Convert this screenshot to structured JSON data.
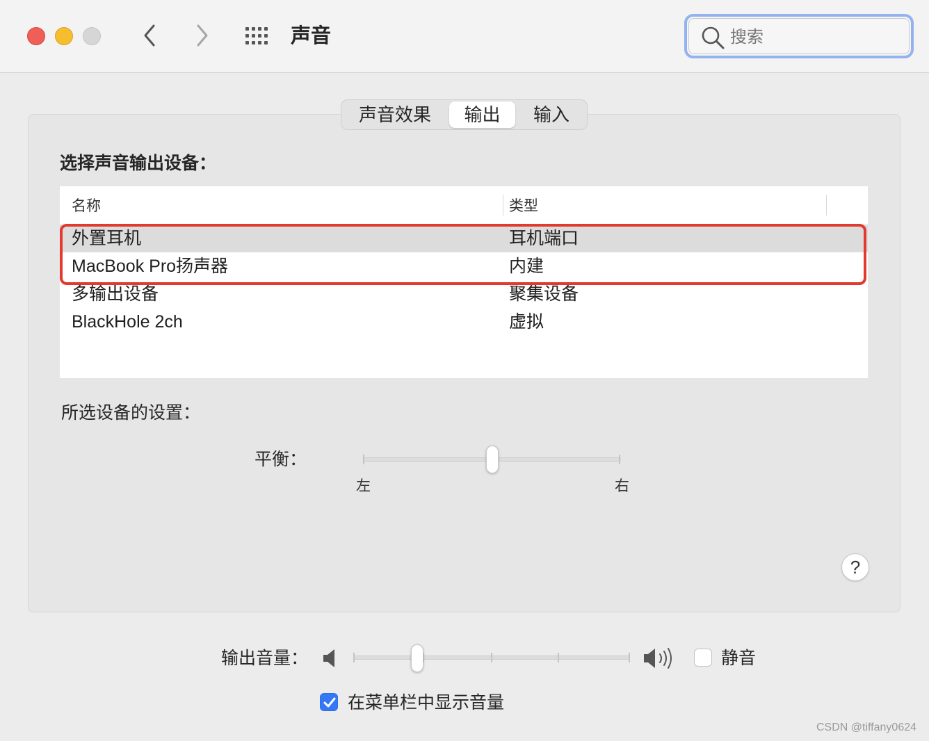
{
  "window": {
    "title": "声音",
    "search_placeholder": "搜索"
  },
  "tabs": [
    {
      "label": "声音效果",
      "selected": false
    },
    {
      "label": "输出",
      "selected": true
    },
    {
      "label": "输入",
      "selected": false
    }
  ],
  "output": {
    "choose_label": "选择声音输出设备：",
    "columns": [
      "名称",
      "类型"
    ],
    "devices": [
      {
        "name": "外置耳机",
        "type": "耳机端口",
        "selected": true
      },
      {
        "name": "MacBook Pro扬声器",
        "type": "内建",
        "selected": false
      },
      {
        "name": "多输出设备",
        "type": "聚集设备",
        "selected": false
      },
      {
        "name": "BlackHole 2ch",
        "type": "虚拟",
        "selected": false
      }
    ],
    "settings_label": "所选设备的设置：",
    "balance": {
      "label": "平衡：",
      "left_label": "左",
      "right_label": "右",
      "value": 0.5
    },
    "help_label": "?"
  },
  "volume": {
    "label": "输出音量：",
    "value": 0.23,
    "mute_label": "静音",
    "mute_checked": false,
    "show_in_menubar_label": "在菜单栏中显示音量",
    "show_in_menubar_checked": true
  },
  "watermark": "CSDN @tiffany0624",
  "colors": {
    "highlight_box": "#e23a2e",
    "checkbox_accent": "#3478f6",
    "search_focus_ring": "#93b2ef"
  }
}
